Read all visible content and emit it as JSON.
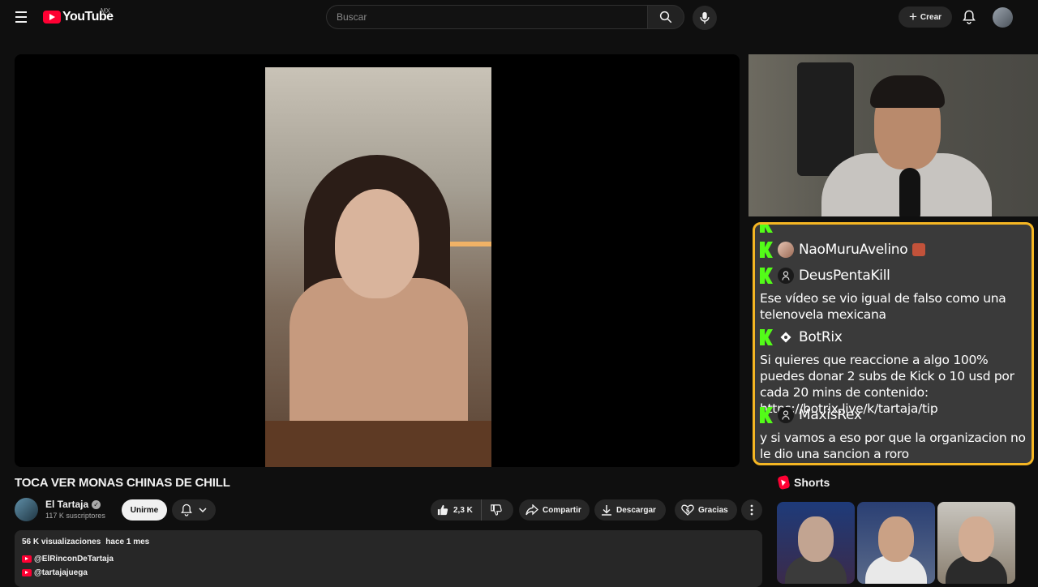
{
  "header": {
    "logo_text": "YouTube",
    "region": "MX",
    "search_placeholder": "Buscar",
    "create_label": "Crear"
  },
  "chat": {
    "messages": [
      {
        "user": "NaoMuruAvelino",
        "text": ""
      },
      {
        "user": "DeusPentaKill",
        "text": "Ese vídeo se vio igual de falso como una telenovela mexicana"
      },
      {
        "user": "BotRix",
        "text": "Si quieres que reaccione a algo 100% puedes donar 2 subs de Kick o 10 usd por cada 20 mins de contenido: https://botrix.live/k/tartaja/tip"
      },
      {
        "user": "MaxisRex",
        "text": "y si vamos a eso por que la organizacion no le dio una sancion a roro"
      }
    ]
  },
  "video": {
    "title": "TOCA VER MONAS CHINAS DE CHILL",
    "channel": "El Tartaja",
    "subscribers": "117 K suscriptores",
    "join_label": "Unirme",
    "likes": "2,3 K",
    "share_label": "Compartir",
    "download_label": "Descargar",
    "thanks_label": "Gracias"
  },
  "description": {
    "views": "56 K visualizaciones",
    "date": "hace 1 mes",
    "links": [
      "@ElRinconDeTartaja",
      "@tartajajuega"
    ]
  },
  "shorts": {
    "heading": "Shorts"
  },
  "colors": {
    "background": "#0f0f0f",
    "chat_border": "#f5b623",
    "kick_green": "#53fc18",
    "youtube_red": "#ff0033"
  }
}
